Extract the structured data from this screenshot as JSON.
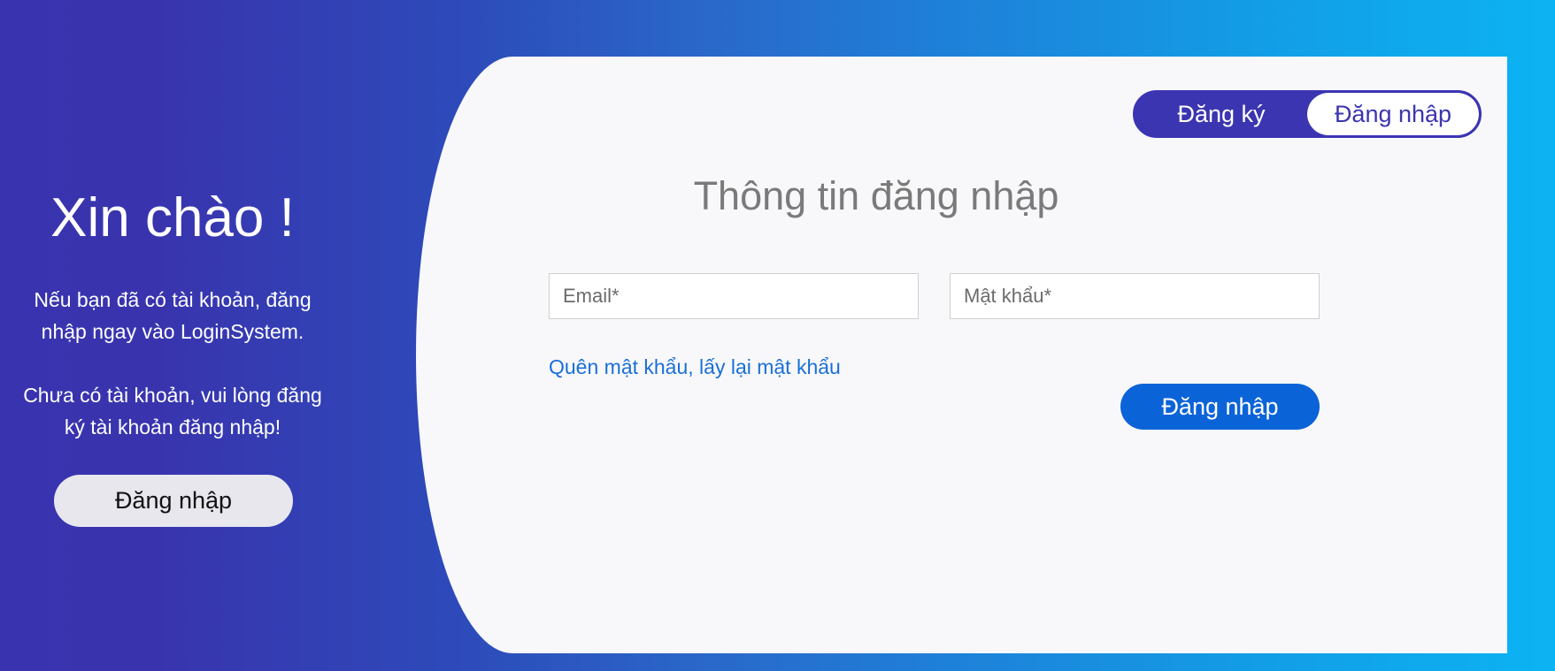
{
  "welcome": {
    "title": "Xin chào !",
    "paragraph1": "Nếu bạn đã có tài khoản, đăng nhập ngay vào LoginSystem.",
    "paragraph2": "Chưa có tài khoản, vui lòng đăng ký tài khoản đăng nhập!",
    "login_button": "Đăng nhập"
  },
  "toggle": {
    "register_label": "Đăng ký",
    "login_label": "Đăng nhập",
    "active": "login"
  },
  "form": {
    "title": "Thông tin đăng nhập",
    "email_placeholder": "Email*",
    "email_value": "",
    "password_placeholder": "Mật khẩu*",
    "password_value": "",
    "forgot_link": "Quên mật khẩu, lấy lại mật khẩu",
    "submit_label": "Đăng nhập"
  },
  "colors": {
    "gradient_start": "#3933af",
    "gradient_end": "#0cb3f3",
    "accent": "#3b35b1",
    "submit": "#0b63d8",
    "link": "#1a6fd6"
  }
}
